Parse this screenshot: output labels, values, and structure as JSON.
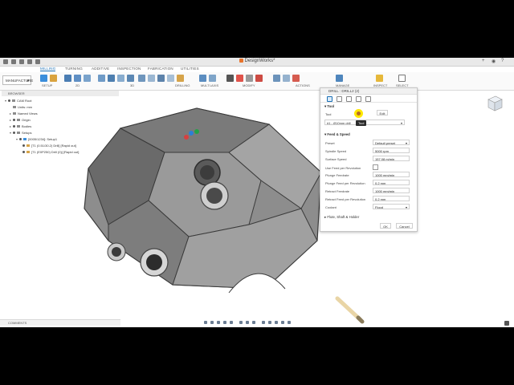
{
  "titlebar": {
    "title": "DesignWorks*"
  },
  "tabs": [
    "MILLING",
    "TURNING",
    "ADDITIVE",
    "INSPECTION",
    "FABRICATION",
    "UTILITIES"
  ],
  "active_tab": "MILLING",
  "toolbar": {
    "workspace": "MANUFACTURE",
    "groups": [
      "SETUP",
      "2D",
      "3D",
      "DRILLING",
      "MULTI-AXIS",
      "MODIFY",
      "ACTIONS",
      "MANAGE",
      "INSPECT",
      "SELECT"
    ]
  },
  "browser": {
    "title": "BROWSER",
    "items": [
      {
        "label": "CAM Root"
      },
      {
        "label": "Units: mm"
      },
      {
        "label": "Named Views"
      },
      {
        "label": "Origin"
      },
      {
        "label": "Bodies"
      },
      {
        "label": "Setups"
      },
      {
        "label": "[0005/1234]: Setup1"
      },
      {
        "label": "[T1 (0.51/30.2) Drill] [Rapid out]"
      },
      {
        "label": "[T1 (E0P250) Drill (0)] [Rapid out]"
      }
    ]
  },
  "panel": {
    "title": "DRILL : DRILL2 (2)",
    "tool_section": "Tool",
    "tool_label": "Tool",
    "edit_label": "Edit",
    "tooltip": "Tool",
    "tool_value": "#1 - Ø10mm drill",
    "feed_section": "Feed & Speed",
    "rows": [
      {
        "label": "Preset",
        "value": "Default preset"
      },
      {
        "label": "Spindle Speed",
        "value": "5000 rpm"
      },
      {
        "label": "Surface Speed",
        "value": "157.08 m/min"
      },
      {
        "label": "Use Feed per Revolution",
        "value": ""
      },
      {
        "label": "Plunge Feedrate",
        "value": "1000 mm/min"
      },
      {
        "label": "Plunge Feed per Revolution",
        "value": "0.2 mm"
      },
      {
        "label": "Retract Feedrate",
        "value": "1000 mm/min"
      },
      {
        "label": "Retract Feed per Revolution",
        "value": "0.2 mm"
      },
      {
        "label": "Coolant",
        "value": "Flood"
      }
    ],
    "shaft_section": "Flute, Shaft & Holder",
    "ok_label": "OK",
    "cancel_label": "Cancel"
  },
  "comments": {
    "label": "COMMENTS"
  },
  "colors": {
    "accent": "#1a6fb5",
    "highlight": "#ffe800",
    "part": "#8f8f8f"
  }
}
